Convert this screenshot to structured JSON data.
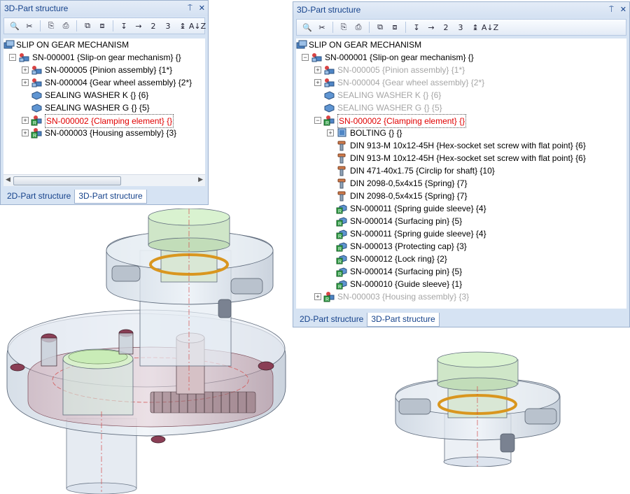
{
  "left_panel": {
    "title": "3D-Part structure",
    "pin": "⍑",
    "close": "✕",
    "toolbar": [
      "🔍",
      "✂",
      "⎘",
      "⎙",
      "⧉",
      "⧈",
      "↧",
      "→",
      "2",
      "3",
      "↨",
      "A↓Z"
    ],
    "tree": [
      {
        "level": 0,
        "label": "SLIP ON GEAR MECHANISM",
        "icon": "assembly-root-icon",
        "expander": "",
        "style": ""
      },
      {
        "level": 1,
        "label": "SN-000001 {Slip-on gear mechanism} {}",
        "icon": "assembly-icon",
        "expander": "−",
        "style": ""
      },
      {
        "level": 2,
        "label": "SN-000005 {Pinion assembly} {1*}",
        "icon": "assembly-icon",
        "expander": "+",
        "style": ""
      },
      {
        "level": 2,
        "label": "SN-000004 {Gear wheel assembly} {2*}",
        "icon": "assembly-icon",
        "expander": "+",
        "style": ""
      },
      {
        "level": 2,
        "label": "SEALING WASHER K {} {6}",
        "icon": "part-icon",
        "expander": "",
        "style": ""
      },
      {
        "level": 2,
        "label": "SEALING WASHER G {} {5}",
        "icon": "part-icon",
        "expander": "",
        "style": ""
      },
      {
        "level": 2,
        "label": "SN-000002 {Clamping element} {}",
        "icon": "referenced-assembly-icon",
        "expander": "+",
        "style": "red-sel"
      },
      {
        "level": 2,
        "label": "SN-000003 {Housing assembly} {3}",
        "icon": "referenced-assembly-icon",
        "expander": "+",
        "style": ""
      }
    ],
    "scroll_left": "◀",
    "scroll_right": "▶",
    "tabs": [
      "2D-Part structure",
      "3D-Part structure"
    ]
  },
  "right_panel": {
    "title": "3D-Part structure",
    "pin": "⍑",
    "close": "✕",
    "tree": [
      {
        "level": 0,
        "label": "SLIP ON GEAR MECHANISM",
        "icon": "assembly-root-icon",
        "expander": "",
        "style": ""
      },
      {
        "level": 1,
        "label": "SN-000001 {Slip-on gear mechanism} {}",
        "icon": "assembly-icon",
        "expander": "−",
        "style": ""
      },
      {
        "level": 2,
        "label": "SN-000005 {Pinion assembly} {1*}",
        "icon": "assembly-icon",
        "expander": "+",
        "style": "gray"
      },
      {
        "level": 2,
        "label": "SN-000004 {Gear wheel assembly} {2*}",
        "icon": "assembly-icon",
        "expander": "+",
        "style": "gray"
      },
      {
        "level": 2,
        "label": "SEALING WASHER K {} {6}",
        "icon": "part-icon",
        "expander": "",
        "style": "gray"
      },
      {
        "level": 2,
        "label": "SEALING WASHER G {} {5}",
        "icon": "part-icon",
        "expander": "",
        "style": "gray"
      },
      {
        "level": 2,
        "label": "SN-000002 {Clamping element} {}",
        "icon": "referenced-assembly-icon",
        "expander": "−",
        "style": "red-sel"
      },
      {
        "level": 3,
        "label": "BOLTING {} {}",
        "icon": "bolting-icon",
        "expander": "+",
        "style": ""
      },
      {
        "level": 3,
        "label": "DIN 913-M 10x12-45H {Hex-socket set screw with flat point} {6}",
        "icon": "screw-icon",
        "expander": "",
        "style": ""
      },
      {
        "level": 3,
        "label": "DIN 913-M 10x12-45H {Hex-socket set screw with flat point} {6}",
        "icon": "screw-icon",
        "expander": "",
        "style": ""
      },
      {
        "level": 3,
        "label": "DIN 471-40x1.75 {Circlip for shaft} {10}",
        "icon": "screw-icon",
        "expander": "",
        "style": ""
      },
      {
        "level": 3,
        "label": "DIN 2098-0,5x4x15 {Spring} {7}",
        "icon": "screw-icon",
        "expander": "",
        "style": ""
      },
      {
        "level": 3,
        "label": "DIN 2098-0,5x4x15 {Spring} {7}",
        "icon": "screw-icon",
        "expander": "",
        "style": ""
      },
      {
        "level": 3,
        "label": "SN-000011 {Spring guide sleeve} {4}",
        "icon": "referenced-part-icon",
        "expander": "",
        "style": ""
      },
      {
        "level": 3,
        "label": "SN-000014 {Surfacing pin} {5}",
        "icon": "referenced-part-icon",
        "expander": "",
        "style": ""
      },
      {
        "level": 3,
        "label": "SN-000011 {Spring guide sleeve} {4}",
        "icon": "referenced-part-icon",
        "expander": "",
        "style": ""
      },
      {
        "level": 3,
        "label": "SN-000013 {Protecting cap} {3}",
        "icon": "referenced-part-icon",
        "expander": "",
        "style": ""
      },
      {
        "level": 3,
        "label": "SN-000012 {Lock ring} {2}",
        "icon": "referenced-part-icon",
        "expander": "",
        "style": ""
      },
      {
        "level": 3,
        "label": "SN-000014 {Surfacing pin} {5}",
        "icon": "referenced-part-icon",
        "expander": "",
        "style": ""
      },
      {
        "level": 3,
        "label": "SN-000010 {Guide sleeve} {1}",
        "icon": "referenced-part-icon",
        "expander": "",
        "style": ""
      },
      {
        "level": 2,
        "label": "SN-000003 {Housing assembly} {3}",
        "icon": "referenced-assembly-icon",
        "expander": "+",
        "style": "gray"
      }
    ],
    "tabs": [
      "2D-Part structure",
      "3D-Part structure"
    ]
  },
  "colors": {
    "highlight_red": "#e00000",
    "disabled_gray": "#a6a6a6",
    "title_blue": "#15428b"
  }
}
